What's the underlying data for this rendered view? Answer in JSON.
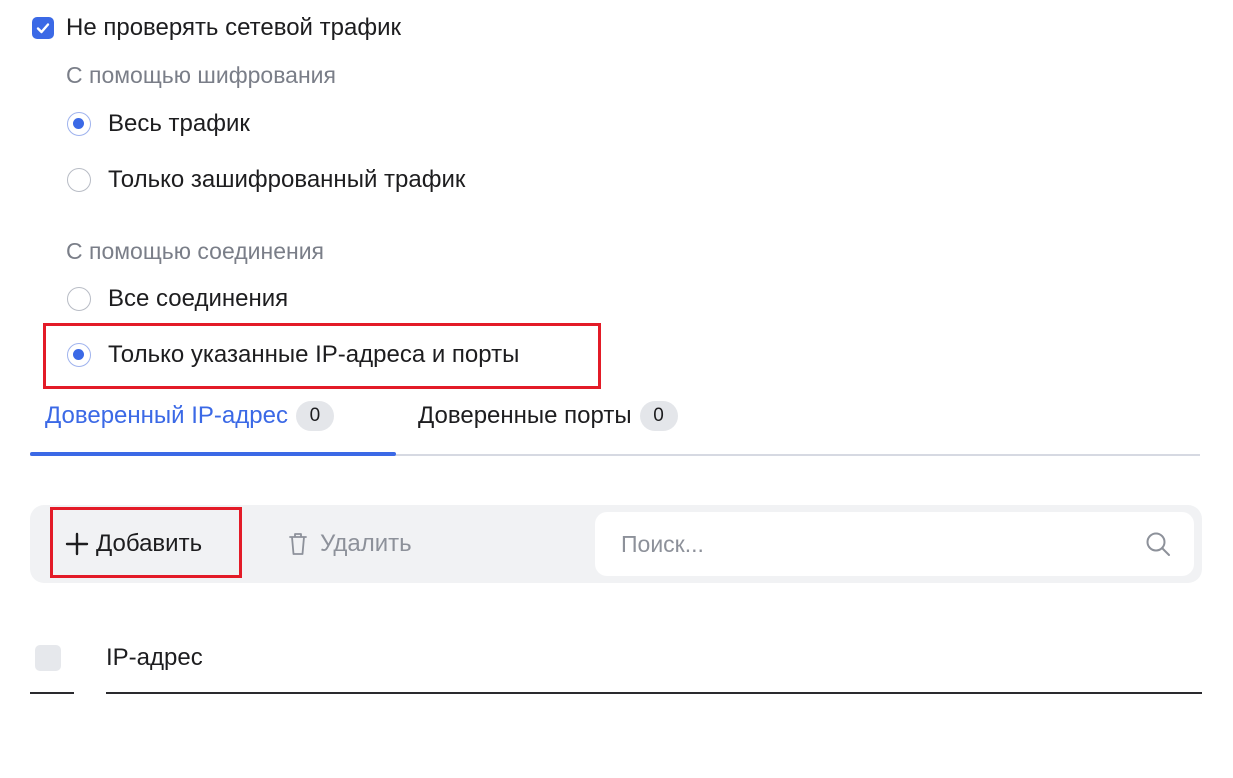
{
  "top_checkbox": {
    "label": "Не проверять сетевой трафик",
    "checked": true
  },
  "encryption_section": {
    "label": "С помощью шифрования",
    "options": [
      {
        "label": "Весь трафик",
        "selected": true
      },
      {
        "label": "Только зашифрованный трафик",
        "selected": false
      }
    ]
  },
  "connection_section": {
    "label": "С помощью соединения",
    "options": [
      {
        "label": "Все соединения",
        "selected": false
      },
      {
        "label": "Только указанные IP-адреса и порты",
        "selected": true
      }
    ]
  },
  "tabs": [
    {
      "label": "Доверенный IP-адрес",
      "count": "0",
      "active": true
    },
    {
      "label": "Доверенные порты",
      "count": "0",
      "active": false
    }
  ],
  "toolbar": {
    "add_label": "Добавить",
    "delete_label": "Удалить",
    "search_placeholder": "Поиск..."
  },
  "table": {
    "columns": [
      "IP-адрес"
    ],
    "rows": []
  },
  "colors": {
    "accent": "#3b69e6",
    "highlight_frame": "#e31b27"
  },
  "icons": {
    "check": "check-icon",
    "plus": "plus-icon",
    "trash": "trash-icon",
    "search": "search-icon"
  }
}
